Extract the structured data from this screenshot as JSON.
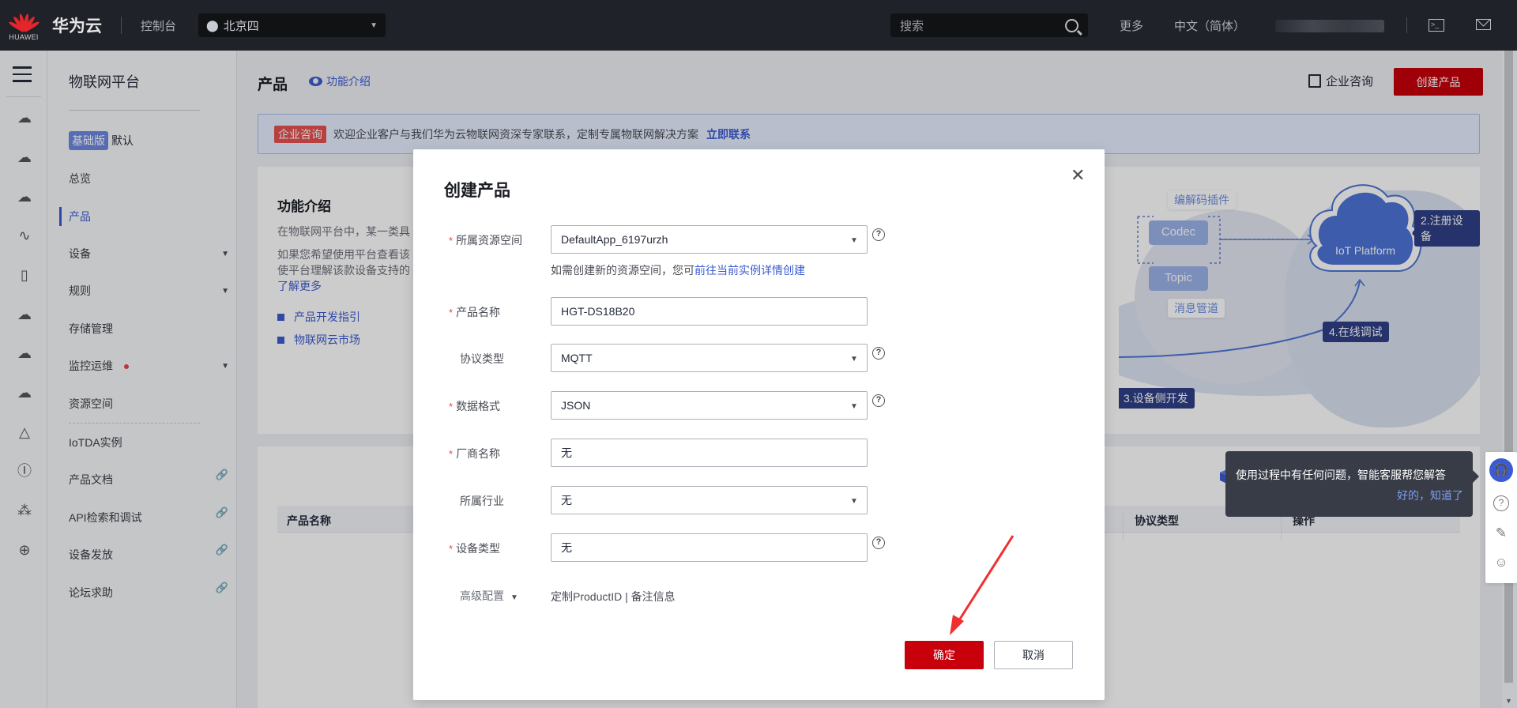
{
  "topbar": {
    "logo_text": "HUAWEI",
    "brand": "华为云",
    "console": "控制台",
    "region": "北京四",
    "search_placeholder": "搜索",
    "more": "更多",
    "language": "中文（简体）",
    "terminal_glyph": ">_"
  },
  "rail": {
    "icons": [
      "cloud-server-icon",
      "cloud-dots-icon",
      "cloud-disk-icon",
      "waveform-icon",
      "phone-cloud-icon",
      "double-cloud-icon",
      "cloud-upload-icon",
      "cloud-play-icon",
      "network-node-icon",
      "ip-icon",
      "cluster-icon",
      "globe-icon"
    ]
  },
  "nav": {
    "title": "物联网平台",
    "edition_badge": "基础版",
    "edition_name": "默认",
    "items": [
      {
        "label": "总览"
      },
      {
        "label": "产品",
        "active": true
      },
      {
        "label": "设备",
        "expandable": true
      },
      {
        "label": "规则",
        "expandable": true
      },
      {
        "label": "存储管理"
      },
      {
        "label": "监控运维",
        "expandable": true,
        "dot": true
      },
      {
        "label": "资源空间"
      },
      {
        "label": "IoTDA实例"
      },
      {
        "label": "产品文档",
        "external": true
      },
      {
        "label": "API检索和调试",
        "external": true
      },
      {
        "label": "设备发放",
        "external": true
      },
      {
        "label": "论坛求助",
        "external": true
      }
    ]
  },
  "main": {
    "page_title": "产品",
    "func_intro": "功能介绍",
    "consult": "企业咨询",
    "create_button": "创建产品",
    "banner": {
      "tag": "企业咨询",
      "text": "欢迎企业客户与我们华为云物联网资深专家联系，定制专属物联网解决方案",
      "link": "立即联系"
    },
    "intro": {
      "title": "功能介绍",
      "p1": "在物联网平台中，某一类具",
      "p2a": "如果您希望使用平台查看该",
      "p2b": "使平台理解该款设备支持的",
      "learn_more": "了解更多",
      "links": [
        "产品开发指引",
        "物联网云市场"
      ]
    },
    "diagram": {
      "codec_tip": "编解码插件",
      "codec": "Codec",
      "topic": "Topic",
      "topic_tip": "消息管道",
      "platform": "IoT Platform",
      "step2": "2.注册设备",
      "step3": "3.设备侧开发",
      "step4": "4.在线调试"
    },
    "table": {
      "columns": [
        "产品名称",
        "协议类型",
        "操作"
      ]
    }
  },
  "tooltip": {
    "text": "使用过程中有任何问题，智能客服帮您解答",
    "ack": "好的，知道了"
  },
  "float_bar": {
    "icons": [
      "customer-service-icon",
      "help-icon",
      "feedback-icon",
      "satisfaction-icon"
    ]
  },
  "modal": {
    "title": "创建产品",
    "fields": [
      {
        "label": "所属资源空间",
        "required": true,
        "type": "select",
        "value": "DefaultApp_6197urzh",
        "help": true
      },
      {
        "label": "产品名称",
        "required": true,
        "type": "input",
        "value": "HGT-DS18B20"
      },
      {
        "label": "协议类型",
        "required": false,
        "type": "select",
        "value": "MQTT",
        "help": true
      },
      {
        "label": "数据格式",
        "required": true,
        "type": "select",
        "value": "JSON",
        "help": true
      },
      {
        "label": "厂商名称",
        "required": true,
        "type": "input",
        "value": "无"
      },
      {
        "label": "所属行业",
        "required": false,
        "type": "select",
        "value": "无"
      },
      {
        "label": "设备类型",
        "required": true,
        "type": "input",
        "value": "无",
        "help": true
      }
    ],
    "hint_text": "如需创建新的资源空间，您可",
    "hint_link": "前往当前实例详情创建",
    "advanced": "高级配置",
    "advanced_items": "定制ProductID | 备注信息",
    "ok": "确定",
    "cancel": "取消",
    "required_mark": "*",
    "help_glyph": "?",
    "close_glyph": "✕"
  },
  "colors": {
    "brand_red": "#c7000b",
    "accent_blue": "#3c5bd1",
    "topbar_bg": "#1f2229",
    "required_red": "#e64545",
    "annotation_arrow": "#f03030"
  }
}
